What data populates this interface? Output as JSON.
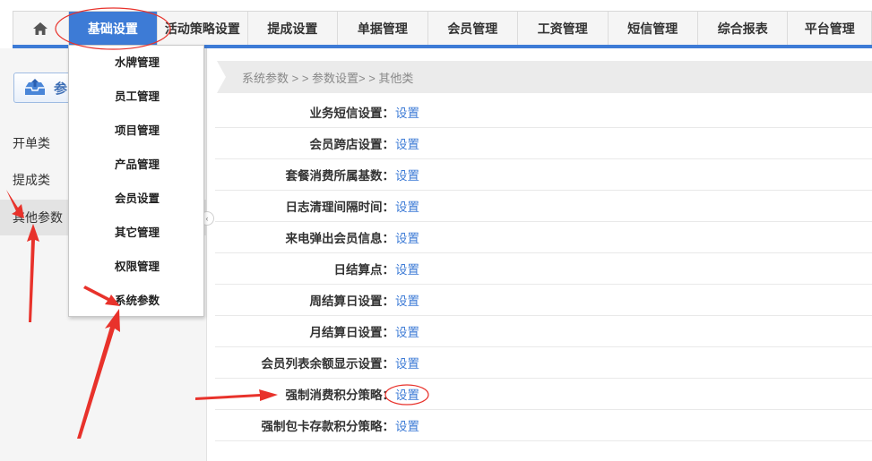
{
  "nav": {
    "home_icon": "home-icon",
    "items": [
      {
        "label": "基础设置",
        "active": true
      },
      {
        "label": "活动策略设置"
      },
      {
        "label": "提成设置"
      },
      {
        "label": "单据管理"
      },
      {
        "label": "会员管理"
      },
      {
        "label": "工资管理"
      },
      {
        "label": "短信管理"
      },
      {
        "label": "综合报表"
      },
      {
        "label": "平台管理"
      }
    ]
  },
  "dropdown": {
    "items": [
      "水牌管理",
      "员工管理",
      "项目管理",
      "产品管理",
      "会员设置",
      "其它管理",
      "权限管理",
      "系统参数"
    ]
  },
  "sidebar": {
    "button_label": "参",
    "items": [
      {
        "label": "开单类"
      },
      {
        "label": "提成类"
      },
      {
        "label": "其他参数",
        "active": true
      }
    ]
  },
  "breadcrumb": "系统参数 > > 参数设置> > 其他类",
  "settings": {
    "link_text": "设置",
    "rows": [
      {
        "label": "业务短信设置："
      },
      {
        "label": "会员跨店设置："
      },
      {
        "label": "套餐消费所属基数："
      },
      {
        "label": "日志清理间隔时间："
      },
      {
        "label": "来电弹出会员信息："
      },
      {
        "label": "日结算点："
      },
      {
        "label": "周结算日设置："
      },
      {
        "label": "月结算日设置："
      },
      {
        "label": "会员列表余额显示设置："
      },
      {
        "label": "强制消费积分策略："
      },
      {
        "label": "强制包卡存款积分策略："
      }
    ]
  },
  "colors": {
    "accent": "#3d7bd6",
    "annotation": "#e8322b"
  }
}
